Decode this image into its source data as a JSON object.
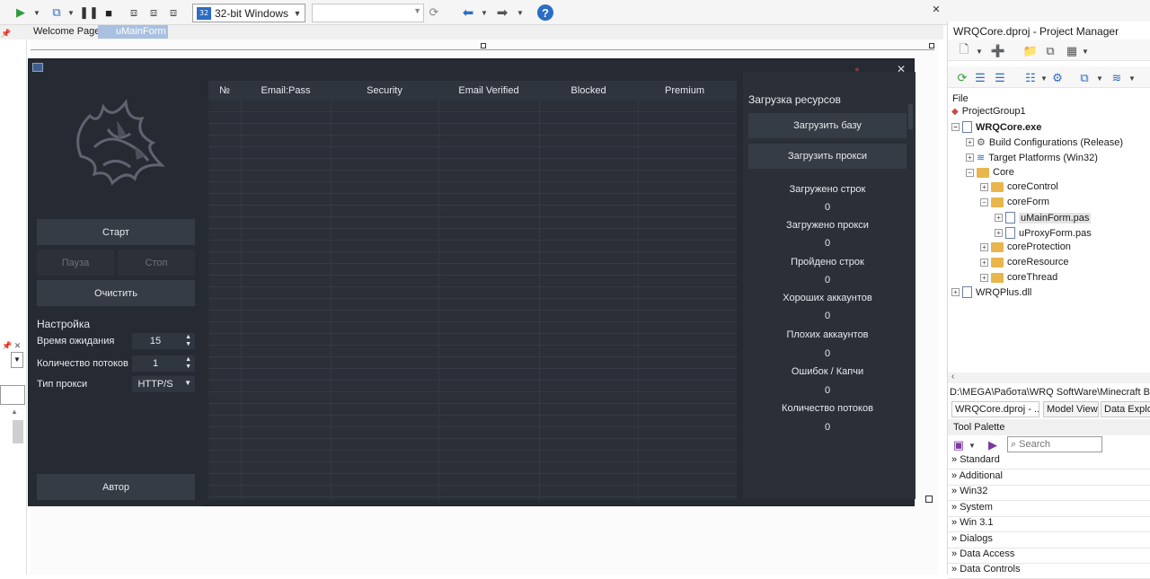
{
  "toolbar": {
    "platform": "32-bit Windows",
    "config_value": ""
  },
  "tabs": [
    {
      "label": "Welcome Page"
    },
    {
      "label": "uMainForm"
    }
  ],
  "app": {
    "left": {
      "start": "Старт",
      "pause": "Пауза",
      "stop": "Стоп",
      "clear": "Очистить",
      "settings_title": "Настройка",
      "timeout_label": "Время ожидания",
      "timeout_value": "15",
      "threads_label": "Количество потоков",
      "threads_value": "1",
      "proxy_label": "Тип прокси",
      "proxy_value": "HTTP/S",
      "author": "Автор"
    },
    "grid": {
      "columns": [
        "№",
        "Email:Pass",
        "Security",
        "Email Verified",
        "Blocked",
        "Premium"
      ]
    },
    "right": {
      "title": "Загрузка ресурсов",
      "load_base": "Загрузить базу",
      "load_proxy": "Загрузить прокси",
      "stats": [
        {
          "label": "Загружено строк",
          "value": "0"
        },
        {
          "label": "Загружено прокси",
          "value": "0"
        },
        {
          "label": "Пройдено строк",
          "value": "0"
        },
        {
          "label": "Хороших аккаунтов",
          "value": "0"
        },
        {
          "label": "Плохих аккаунтов",
          "value": "0"
        },
        {
          "label": "Ошибок / Капчи",
          "value": "0"
        },
        {
          "label": "Количество потоков",
          "value": "0"
        }
      ]
    }
  },
  "pm": {
    "title": "WRQCore.dproj - Project Manager",
    "file_label": "File",
    "tree": [
      {
        "label": "ProjectGroup1"
      },
      {
        "label": "WRQCore.exe"
      },
      {
        "label": "Build Configurations (Release)"
      },
      {
        "label": "Target Platforms (Win32)"
      },
      {
        "label": "Core"
      },
      {
        "label": "coreControl"
      },
      {
        "label": "coreForm"
      },
      {
        "label": "uMainForm.pas"
      },
      {
        "label": "uProxyForm.pas"
      },
      {
        "label": "coreProtection"
      },
      {
        "label": "coreResource"
      },
      {
        "label": "coreThread"
      },
      {
        "label": "WRQPlus.dll"
      }
    ],
    "path": "D:\\MEGA\\Работа\\WRQ SoftWare\\Minecraft BC b",
    "tabs": [
      {
        "label": "WRQCore.dproj - ..."
      },
      {
        "label": "Model View"
      },
      {
        "label": "Data Explore"
      }
    ]
  },
  "palette": {
    "title": "Tool Palette",
    "search_placeholder": "Search",
    "items": [
      {
        "label": "Standard"
      },
      {
        "label": "Additional"
      },
      {
        "label": "Win32"
      },
      {
        "label": "System"
      },
      {
        "label": "Win 3.1"
      },
      {
        "label": "Dialogs"
      },
      {
        "label": "Data Access"
      },
      {
        "label": "Data Controls"
      }
    ]
  }
}
